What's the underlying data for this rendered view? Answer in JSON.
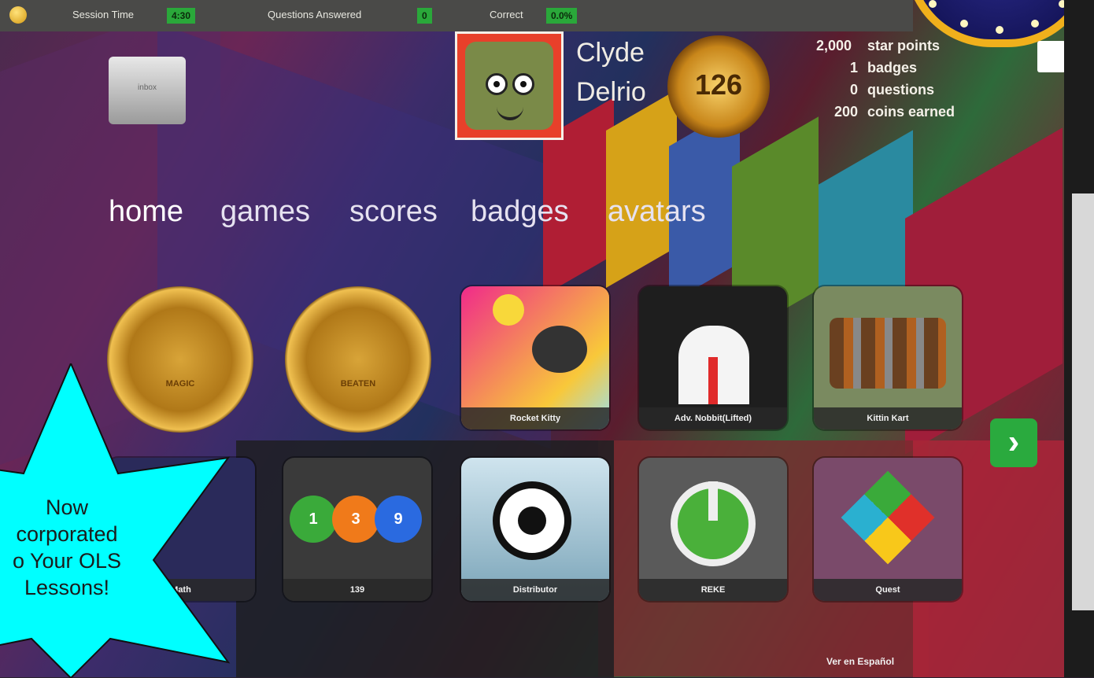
{
  "top_bar": {
    "session_time_label": "Session Time",
    "session_time_value": "4:30",
    "questions_answered_label": "Questions Answered",
    "questions_answered_value": "0",
    "correct_label": "Correct",
    "correct_value": "0.0%"
  },
  "user": {
    "first_name": "Clyde",
    "last_name": "Delrio",
    "level": "126"
  },
  "stats": [
    {
      "value": "2,000",
      "label": "star points"
    },
    {
      "value": "1",
      "label": "badges"
    },
    {
      "value": "0",
      "label": "questions"
    },
    {
      "value": "200",
      "label": "coins earned"
    }
  ],
  "inbox_label": "inbox",
  "nav": [
    "home",
    "games",
    "scores",
    "badges",
    "avatars"
  ],
  "badges": [
    {
      "label": "MAGIC"
    },
    {
      "label": "BEATEN"
    }
  ],
  "games_row1": [
    "Rocket Kitty",
    "Adv. Nobbit(Lifted)",
    "Kittin Kart"
  ],
  "games_row2": [
    "Math",
    "139",
    "Distributor",
    "REKE",
    "Quest"
  ],
  "footer_link": "Ver en Español",
  "callout": {
    "text_lines": [
      "Now",
      "corporated",
      "o Your OLS",
      "Lessons!"
    ],
    "color": "#00FFFF"
  },
  "colors": {
    "accent_green": "#2aaa3e",
    "topbar": "#4a4a48",
    "avatar_frame": "#e8402a"
  }
}
